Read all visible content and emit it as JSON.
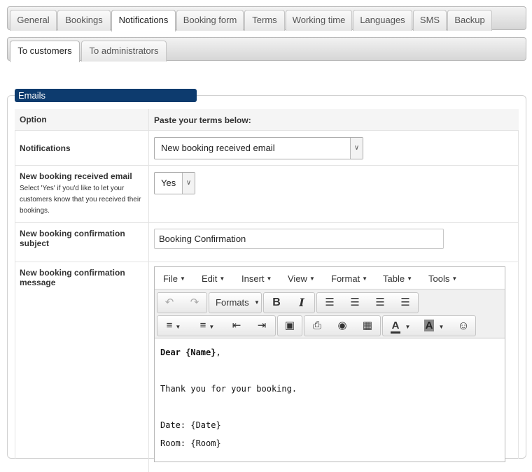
{
  "tabs": [
    "General",
    "Bookings",
    "Notifications",
    "Booking form",
    "Terms",
    "Working time",
    "Languages",
    "SMS",
    "Backup"
  ],
  "subtabs": [
    "To customers",
    "To administrators"
  ],
  "section_title": "Emails",
  "table": {
    "header_option": "Option",
    "header_value": "Paste your terms below:",
    "notifications_label": "Notifications",
    "notifications_value": "New booking received email",
    "received_label": "New booking received email",
    "received_hint": "Select 'Yes' if you'd like to let your customers know that you received their bookings.",
    "received_value": "Yes",
    "subject_label": "New booking confirmation subject",
    "subject_value": "Booking Confirmation",
    "message_label": "New booking confirmation message"
  },
  "editor": {
    "menus": [
      "File",
      "Edit",
      "Insert",
      "View",
      "Format",
      "Table",
      "Tools"
    ],
    "formats_label": "Formats",
    "content": {
      "greeting_bold": "Dear {Name}",
      "greeting_tail": ",",
      "line1": "Thank you for your booking.",
      "line2": "Date: {Date}",
      "line3": "Room: {Room}"
    }
  }
}
